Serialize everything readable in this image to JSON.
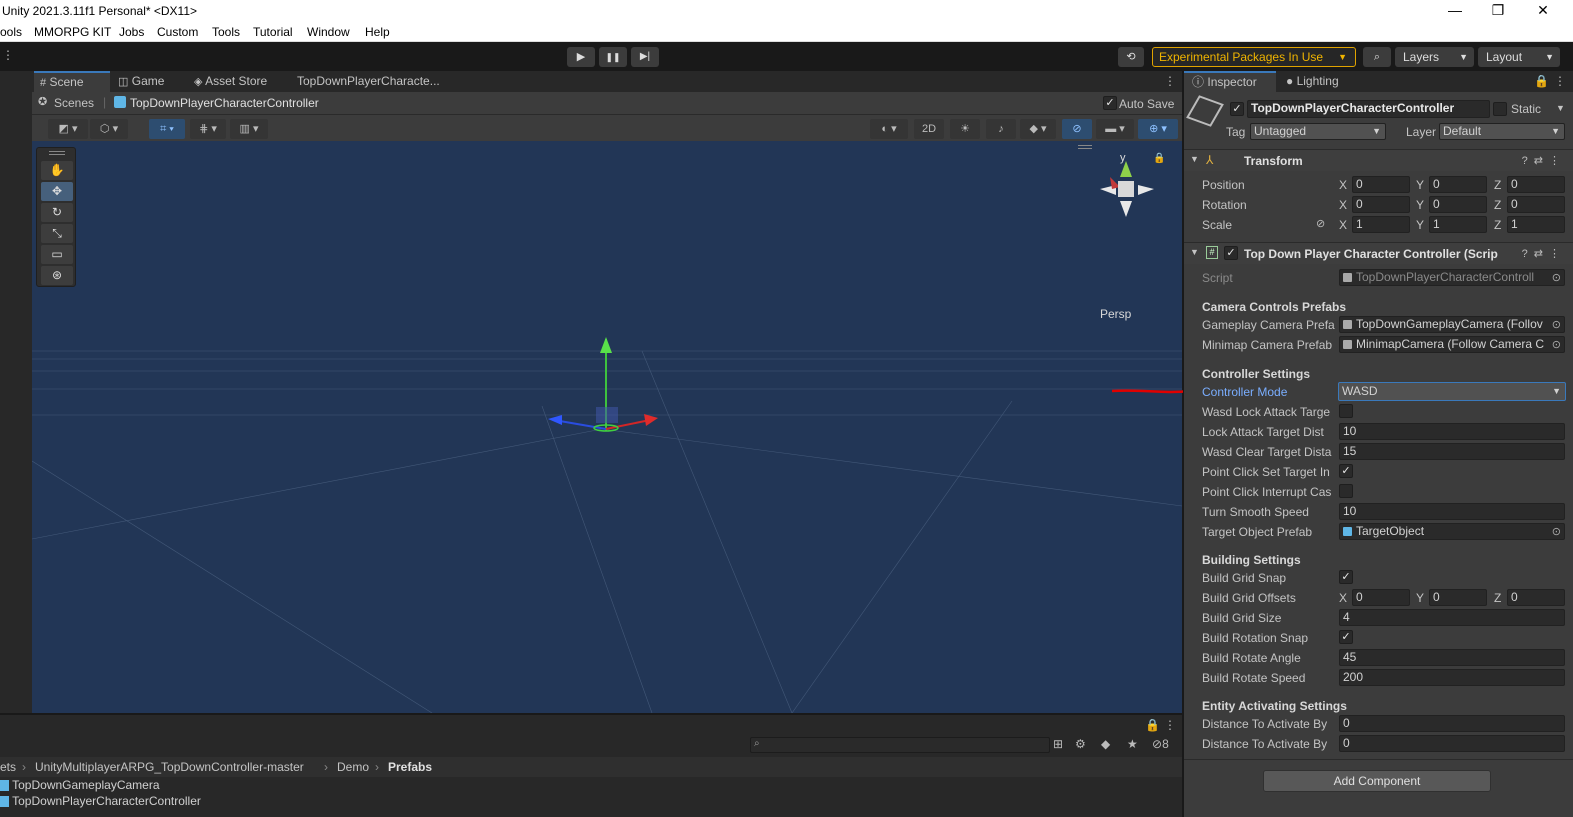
{
  "window": {
    "title": "Unity 2021.3.11f1 Personal* <DX11>",
    "minimize": "—",
    "maximize": "❐",
    "close": "✕"
  },
  "menu": [
    "ools",
    "MMORPG KIT",
    "Jobs",
    "Custom",
    "Tools",
    "Tutorial",
    "Window",
    "Help"
  ],
  "toolbar": {
    "play": "▶",
    "pause": "❚❚",
    "step": "▶|",
    "experimental": "Experimental Packages In Use",
    "layers": "Layers",
    "layout": "Layout"
  },
  "scene": {
    "tabs": [
      "Scene",
      "Game",
      "Asset Store",
      "TopDownPlayerCharacte..."
    ],
    "breadcrumb_root": "Scenes",
    "breadcrumb_object": "TopDownPlayerCharacterController",
    "auto_save": "Auto Save",
    "mode_2d": "2D",
    "persp": "Persp",
    "gizmo_y": "y"
  },
  "project": {
    "breadcrumb": [
      "ets",
      "UnityMultiplayerARPG_TopDownController-master",
      "Demo",
      "Prefabs"
    ],
    "items": [
      "TopDownGameplayCamera",
      "TopDownPlayerCharacterController"
    ],
    "hidden_count": "8"
  },
  "inspector": {
    "tabs": [
      "Inspector",
      "Lighting"
    ],
    "object_name": "TopDownPlayerCharacterController",
    "static_label": "Static",
    "tag_label": "Tag",
    "tag_value": "Untagged",
    "layer_label": "Layer",
    "layer_value": "Default",
    "transform": {
      "title": "Transform",
      "position": {
        "label": "Position",
        "x": "0",
        "y": "0",
        "z": "0"
      },
      "rotation": {
        "label": "Rotation",
        "x": "0",
        "y": "0",
        "z": "0"
      },
      "scale": {
        "label": "Scale",
        "x": "1",
        "y": "1",
        "z": "1"
      }
    },
    "component": {
      "title": "Top Down Player Character Controller (Scrip",
      "script_label": "Script",
      "script_value": "TopDownPlayerCharacterControll",
      "camera_section": "Camera Controls Prefabs",
      "gameplay_camera_label": "Gameplay Camera Prefa",
      "gameplay_camera_value": "TopDownGameplayCamera (Follov",
      "minimap_camera_label": "Minimap Camera Prefab",
      "minimap_camera_value": "MinimapCamera (Follow Camera C",
      "controller_section": "Controller Settings",
      "controller_mode_label": "Controller Mode",
      "controller_mode_value": "WASD",
      "wasd_lock_label": "Wasd Lock Attack Targe",
      "wasd_lock_checked": false,
      "lock_dist_label": "Lock Attack Target Dist",
      "lock_dist_value": "10",
      "wasd_clear_label": "Wasd Clear Target Dista",
      "wasd_clear_value": "15",
      "point_click_set_label": "Point Click Set Target In",
      "point_click_set_checked": true,
      "point_click_interrupt_label": "Point Click Interrupt Cas",
      "point_click_interrupt_checked": false,
      "turn_smooth_label": "Turn Smooth Speed",
      "turn_smooth_value": "10",
      "target_prefab_label": "Target Object Prefab",
      "target_prefab_value": "TargetObject",
      "building_section": "Building Settings",
      "build_grid_snap_label": "Build Grid Snap",
      "build_grid_snap_checked": true,
      "build_grid_offsets_label": "Build Grid Offsets",
      "build_grid_offsets": {
        "x": "0",
        "y": "0",
        "z": "0"
      },
      "build_grid_size_label": "Build Grid Size",
      "build_grid_size_value": "4",
      "build_rotation_snap_label": "Build Rotation Snap",
      "build_rotation_snap_checked": true,
      "build_rotate_angle_label": "Build Rotate Angle",
      "build_rotate_angle_value": "45",
      "build_rotate_speed_label": "Build Rotate Speed",
      "build_rotate_speed_value": "200",
      "entity_section": "Entity Activating Settings",
      "distance1_label": "Distance To Activate By",
      "distance1_value": "0",
      "distance2_label": "Distance To Activate By",
      "distance2_value": "0"
    },
    "add_component": "Add Component"
  },
  "colors": {
    "accent": "#3a79bb",
    "viewport": "#223656",
    "warning": "#f0b400",
    "annotation_arrow": "#e00000"
  }
}
